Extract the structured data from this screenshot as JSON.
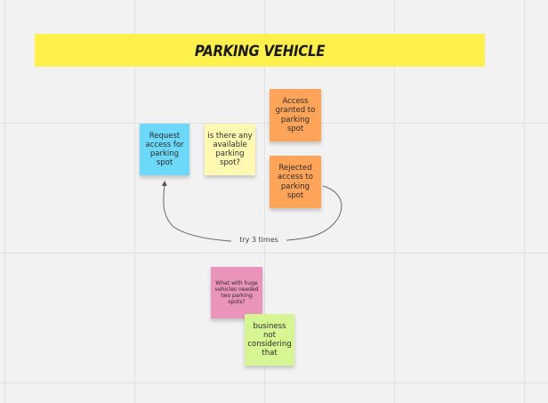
{
  "board": {
    "background_color": "#f2f2f2",
    "grid_color": "#e0e0e0"
  },
  "title": {
    "text": "PARKING VEHICLE",
    "color": "#fff04b"
  },
  "notes": {
    "request_access": {
      "text": "Request access for parking spot",
      "color": "#6cd8fa"
    },
    "available_question": {
      "text": "is there any available parking spot?",
      "color": "#fff9b1"
    },
    "access_granted": {
      "text": "Access granted to parking spot",
      "color": "#ffa459"
    },
    "access_rejected": {
      "text": "Rejected access to parking spot",
      "color": "#ffa459"
    },
    "huge_vehicles_question": {
      "text": "What with huge vehicles needed two parking spots?",
      "color": "#ea94bb"
    },
    "business_note": {
      "text": "business not considering that",
      "color": "#d5f692"
    }
  },
  "connector": {
    "label": "try 3 times",
    "from": "access_rejected",
    "to": "request_access"
  }
}
